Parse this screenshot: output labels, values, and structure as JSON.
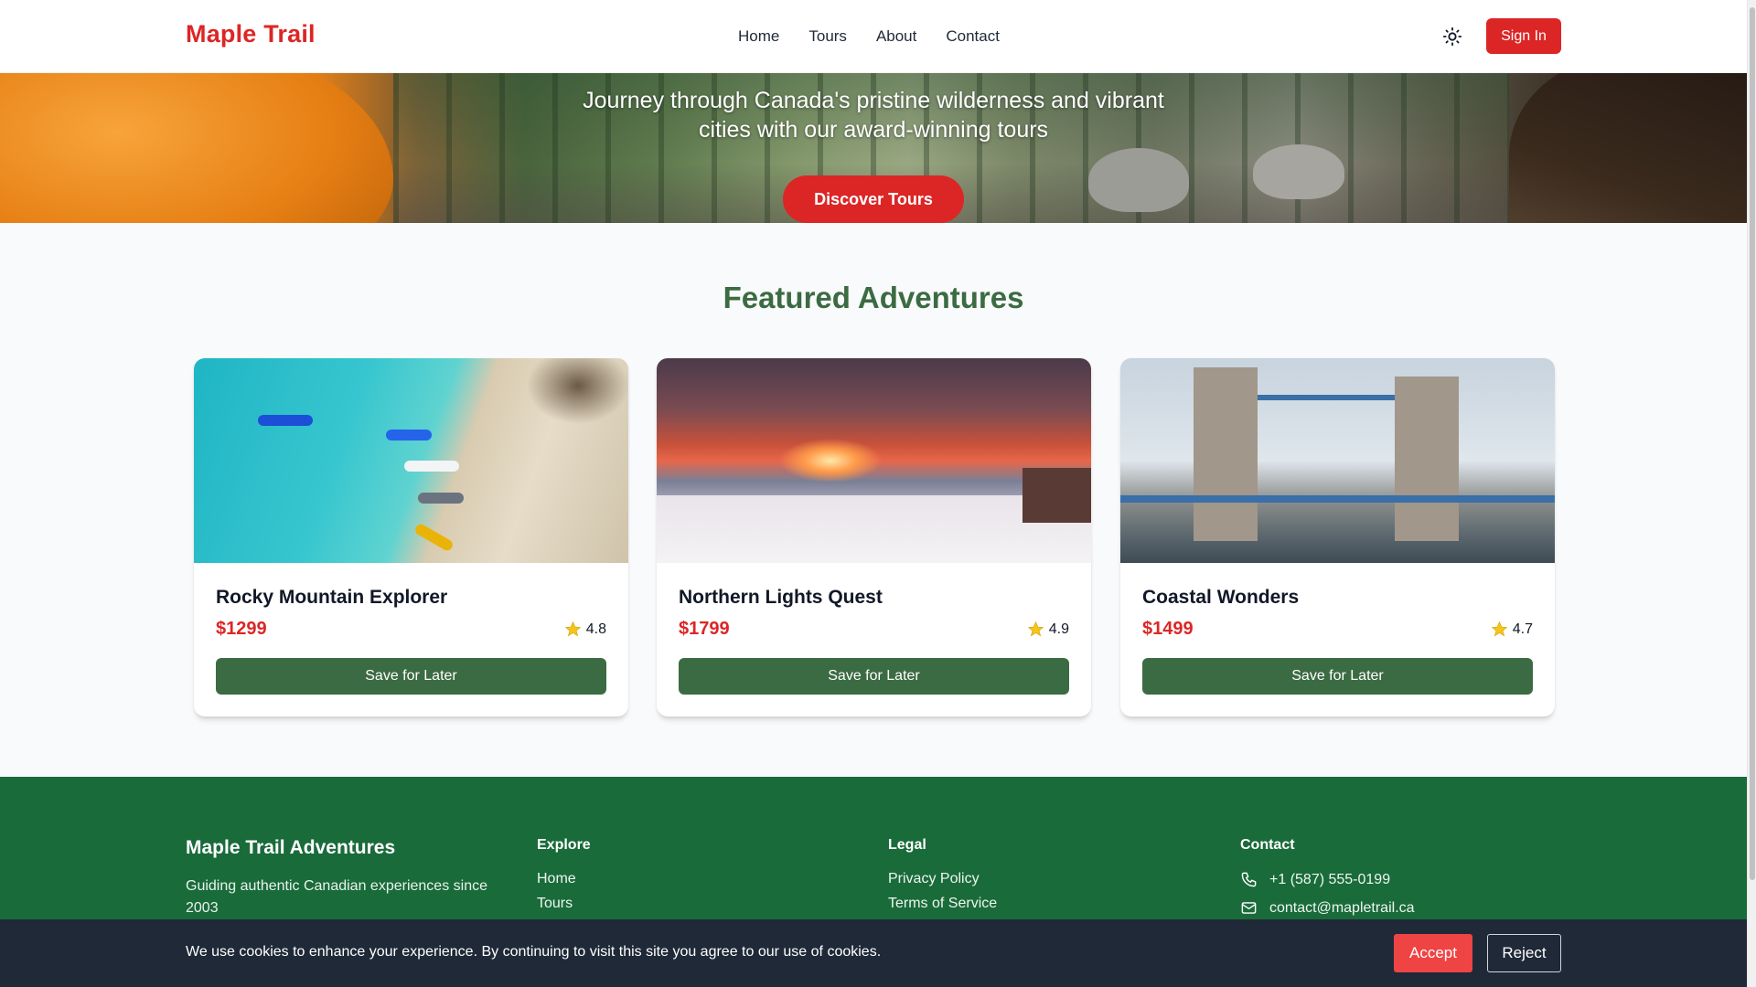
{
  "header": {
    "brand": "Maple Trail",
    "nav": [
      "Home",
      "Tours",
      "About",
      "Contact"
    ],
    "theme_icon": "sun-icon",
    "sign_in": "Sign In"
  },
  "hero": {
    "subtitle": "Journey through Canada's pristine wilderness and vibrant cities with our award-winning tours",
    "cta": "Discover Tours"
  },
  "featured": {
    "title": "Featured Adventures",
    "cards": [
      {
        "title": "Rocky Mountain Explorer",
        "price": "$1299",
        "rating": "4.8",
        "button": "Save for Later",
        "image": "tropical beach with boats"
      },
      {
        "title": "Northern Lights Quest",
        "price": "$1799",
        "rating": "4.9",
        "button": "Save for Later",
        "image": "snowy mountain sunset"
      },
      {
        "title": "Coastal Wonders",
        "price": "$1499",
        "rating": "4.7",
        "button": "Save for Later",
        "image": "tower bridge"
      }
    ],
    "star_color": "#f5c518"
  },
  "footer": {
    "brand": "Maple Trail Adventures",
    "tagline": "Guiding authentic Canadian experiences since 2003",
    "explore": {
      "title": "Explore",
      "links": [
        "Home",
        "Tours"
      ]
    },
    "legal": {
      "title": "Legal",
      "links": [
        "Privacy Policy",
        "Terms of Service"
      ]
    },
    "contact": {
      "title": "Contact",
      "phone": "+1 (587) 555-0199",
      "email": "contact@mapletrail.ca"
    }
  },
  "cookie": {
    "message": "We use cookies to enhance your experience. By continuing to visit this site you agree to our use of cookies.",
    "accept": "Accept",
    "reject": "Reject"
  },
  "colors": {
    "brand_red": "#dc2626",
    "forest_green": "#3b6b42",
    "footer_green": "#1a6b3a",
    "cookie_bg": "#1f2937"
  }
}
